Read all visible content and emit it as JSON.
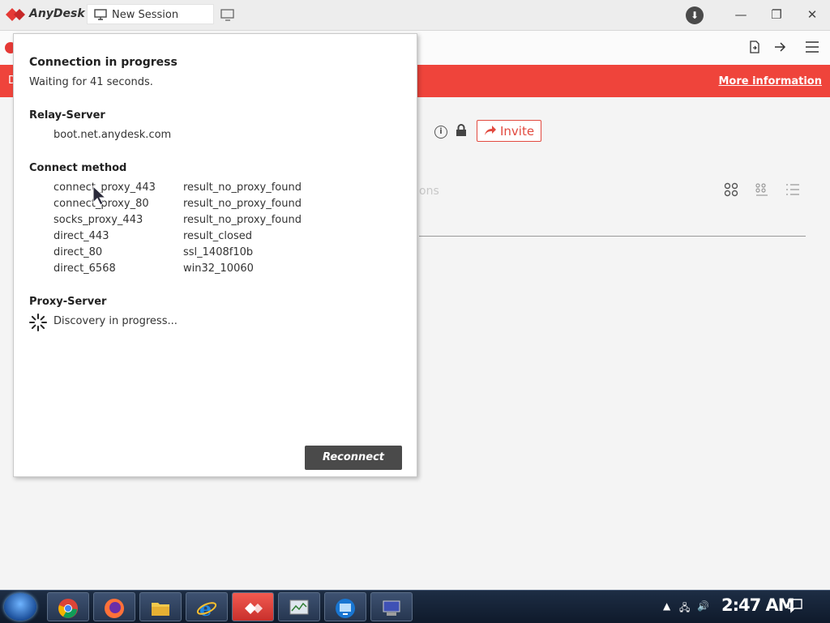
{
  "titlebar": {
    "app_name": "AnyDesk",
    "tab_label": "New Session"
  },
  "banner": {
    "left_text": "D",
    "more_info": "More information"
  },
  "main": {
    "invite_label": "Invite",
    "faded_tab": "ons"
  },
  "popup": {
    "title": "Connection in progress",
    "subtitle": "Waiting for 41 seconds.",
    "relay_header": "Relay-Server",
    "relay_server": "boot.net.anydesk.com",
    "connect_header": "Connect method",
    "connect_methods": [
      {
        "name": "connect_proxy_443",
        "result": "result_no_proxy_found"
      },
      {
        "name": "connect_proxy_80",
        "result": "result_no_proxy_found"
      },
      {
        "name": "socks_proxy_443",
        "result": "result_no_proxy_found"
      },
      {
        "name": "direct_443",
        "result": "result_closed"
      },
      {
        "name": "direct_80",
        "result": "ssl_1408f10b"
      },
      {
        "name": "direct_6568",
        "result": "win32_10060"
      }
    ],
    "proxy_header": "Proxy-Server",
    "proxy_status": "Discovery in progress...",
    "reconnect_label": "Reconnect"
  },
  "taskbar": {
    "apps": [
      "chrome-icon",
      "firefox-icon",
      "file-explorer-icon",
      "internet-explorer-icon",
      "anydesk-icon",
      "resource-monitor-icon",
      "remote-desktop-icon",
      "network-app-icon"
    ],
    "clock": "2:47 AM"
  },
  "colors": {
    "accent": "#ef443b",
    "button_dark": "#4a4a4a"
  }
}
